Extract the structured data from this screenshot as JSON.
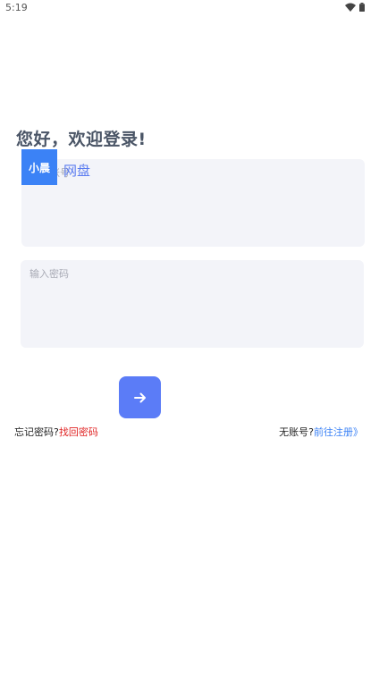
{
  "status_bar": {
    "time": "5:19",
    "icons": [
      "wifi-icon",
      "battery-icon"
    ]
  },
  "greeting": "您好，欢迎登录!",
  "brand": {
    "badge_text": "小晨",
    "name": "网盘",
    "badge_color": "#3b82f6"
  },
  "account_field": {
    "placeholder": "输入账号"
  },
  "password_field": {
    "placeholder": "输入密码"
  },
  "submit": {
    "icon": "arrow-right-icon",
    "color": "#5b7cf7"
  },
  "forgot": {
    "prompt": "忘记密码?",
    "link": "找回密码",
    "link_color": "#e02424"
  },
  "register": {
    "prompt": "无账号?",
    "link": "前往注册》",
    "link_color": "#3b82f6"
  }
}
